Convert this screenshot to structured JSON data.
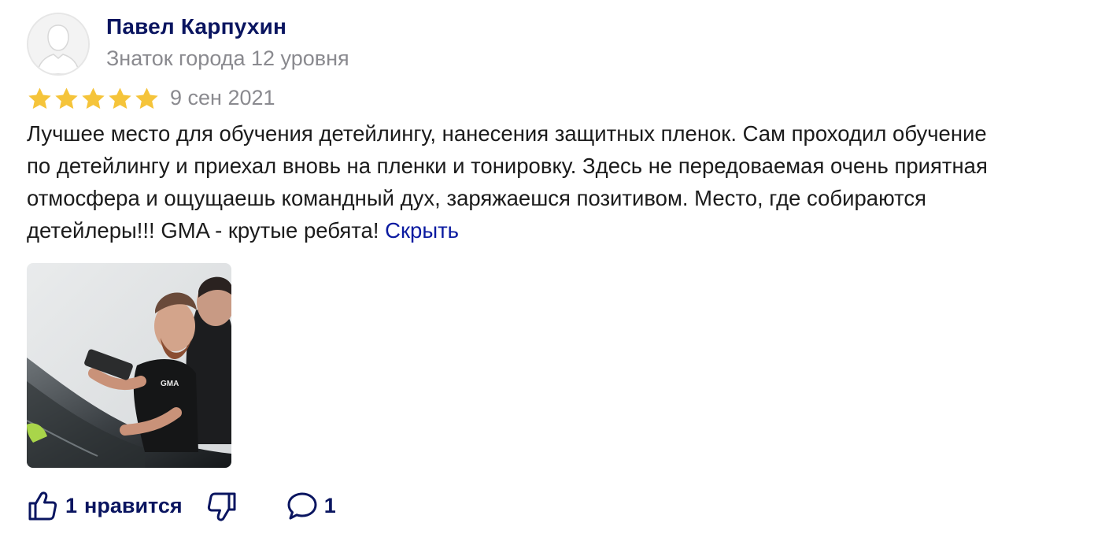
{
  "author": {
    "name": "Павел Карпухин",
    "level": "Знаток города 12 уровня",
    "avatar_icon": "user-silhouette-icon"
  },
  "rating": {
    "stars": 5,
    "max": 5,
    "star_color": "#f5c43a"
  },
  "date": "9 сен 2021",
  "review": {
    "lines": [
      "Лучшее место для обучения детейлингу, нанесения защитных пленок. Сам проходил обучение",
      "по детейлингу и приехал вновь на пленки и тонировку. Здесь не передоваемая очень приятная",
      "отмосфера и ощущаешь командный дух, заряжаешся позитивом. Место, где собираются",
      "детейлеры!!! GMA - крутые ребята! "
    ],
    "hide_link": "Скрыть"
  },
  "photo": {
    "logo_text": "GMA"
  },
  "actions": {
    "like_icon": "thumbs-up-icon",
    "like_count": "1",
    "like_label": "нравится",
    "dislike_icon": "thumbs-down-icon",
    "comment_icon": "comment-bubble-icon",
    "comment_count": "1"
  },
  "colors": {
    "name": "#0a1560",
    "link": "#0a1aa0",
    "meta": "#8a8a8f",
    "text": "#1b1b1b"
  }
}
